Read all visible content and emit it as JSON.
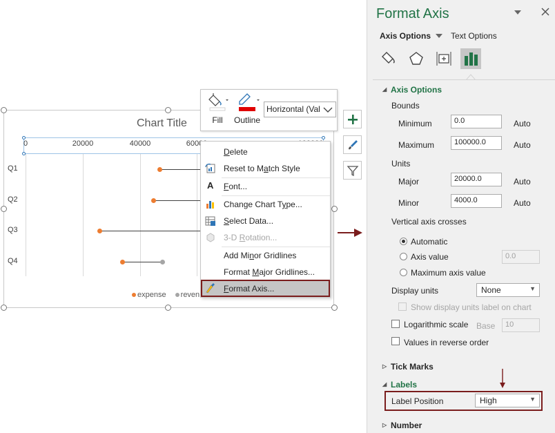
{
  "chart": {
    "title": "Chart Title",
    "x_ticks": [
      "0",
      "20000",
      "40000",
      "60000",
      "100000"
    ],
    "categories": [
      "Q1",
      "Q2",
      "Q3",
      "Q4"
    ],
    "legend": [
      "expense",
      "reven"
    ],
    "colors": {
      "expense": "#ed7d31",
      "revenue": "#a5a5a5"
    }
  },
  "chart_data": {
    "type": "scatter",
    "title": "Chart Title",
    "xlim": [
      0,
      100000
    ],
    "categories": [
      "Q1",
      "Q2",
      "Q3",
      "Q4"
    ],
    "series": [
      {
        "name": "expense",
        "values": [
          47000,
          45000,
          26000,
          34000
        ]
      },
      {
        "name": "revenue",
        "values": [
          68000,
          68000,
          68000,
          48000
        ]
      }
    ]
  },
  "mini_toolbar": {
    "fill_label": "Fill",
    "outline_label": "Outline",
    "element_select": "Horizontal (Val",
    "outline_color": "#e00000"
  },
  "context_menu": {
    "items": [
      {
        "label": "Delete",
        "icon": "none",
        "enabled": true
      },
      {
        "label": "Reset to Match Style",
        "icon": "reset-style-icon",
        "enabled": true
      },
      {
        "label": "Font...",
        "icon": "font-icon",
        "enabled": true
      },
      {
        "label": "Change Chart Type...",
        "icon": "chart-type-icon",
        "enabled": true
      },
      {
        "label": "Select Data...",
        "icon": "select-data-icon",
        "enabled": true
      },
      {
        "label": "3-D Rotation...",
        "icon": "rotation-icon",
        "enabled": false
      },
      {
        "label": "Add Minor Gridlines",
        "icon": "none",
        "enabled": true
      },
      {
        "label": "Format Major Gridlines...",
        "icon": "none",
        "enabled": true
      },
      {
        "label": "Format Axis...",
        "icon": "format-axis-icon",
        "enabled": true,
        "highlighted": true
      }
    ]
  },
  "panel": {
    "title": "Format Axis",
    "tab_axis_options": "Axis Options",
    "tab_text_options": "Text Options",
    "axis_options_header": "Axis Options",
    "bounds_label": "Bounds",
    "minimum_label": "Minimum",
    "minimum_value": "0.0",
    "maximum_label": "Maximum",
    "maximum_value": "100000.0",
    "auto_label": "Auto",
    "units_label": "Units",
    "major_label": "Major",
    "major_value": "20000.0",
    "minor_label": "Minor",
    "minor_value": "4000.0",
    "vertical_crosses_label": "Vertical axis crosses",
    "radio_automatic": "Automatic",
    "radio_axis_value": "Axis value",
    "axis_value_input": "0.0",
    "radio_max_axis": "Maximum axis value",
    "display_units_label": "Display units",
    "display_units_value": "None",
    "show_units_label": "Show display units label on chart",
    "log_scale_label": "Logarithmic scale",
    "base_label": "Base",
    "base_value": "10",
    "reverse_label": "Values in reverse order",
    "tick_marks_header": "Tick Marks",
    "labels_header": "Labels",
    "label_position_label": "Label Position",
    "label_position_value": "High",
    "number_header": "Number",
    "accent": "#217346"
  }
}
